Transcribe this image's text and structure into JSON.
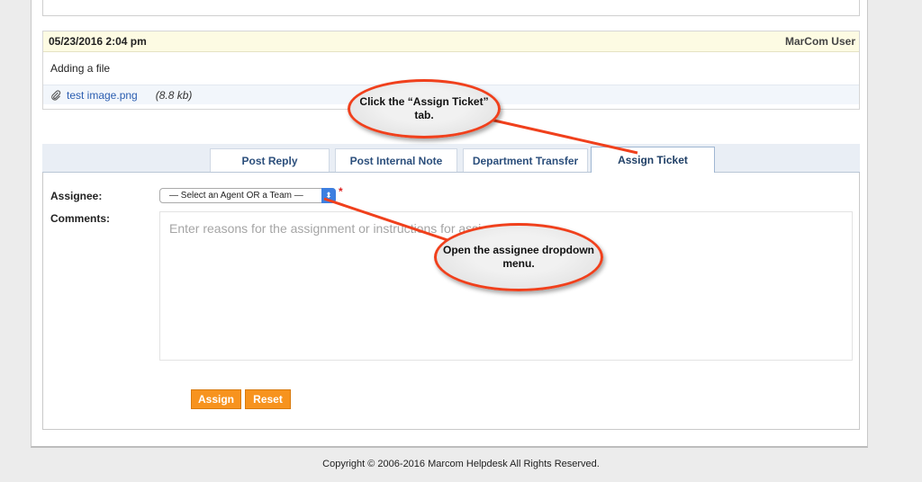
{
  "thread": {
    "timestamp": "05/23/2016 2:04 pm",
    "author": "MarCom User",
    "body": "Adding a file",
    "attachment": {
      "name": "test image.png",
      "size": "(8.8 kb)",
      "icon": "paperclip-icon"
    }
  },
  "tabs": [
    {
      "label": "Post Reply"
    },
    {
      "label": "Post Internal Note"
    },
    {
      "label": "Department Transfer"
    },
    {
      "label": "Assign Ticket",
      "active": true
    }
  ],
  "form": {
    "assignee_label": "Assignee:",
    "assignee_selected": "— Select an Agent OR a Team —",
    "required_mark": "*",
    "comments_label": "Comments:",
    "comments_placeholder": "Enter reasons for the assignment or instructions for assignee",
    "assign_button": "Assign",
    "reset_button": "Reset"
  },
  "footer": {
    "copyright": "Copyright © 2006-2016 Marcom Helpdesk All Rights Reserved."
  },
  "callouts": [
    {
      "text": "Click the “Assign Ticket” tab."
    },
    {
      "text": "Open the assignee dropdown menu."
    }
  ],
  "colors": {
    "accent_button": "#f7931e",
    "callout_border": "#f0401c",
    "thread_header": "#fdfbe3"
  }
}
